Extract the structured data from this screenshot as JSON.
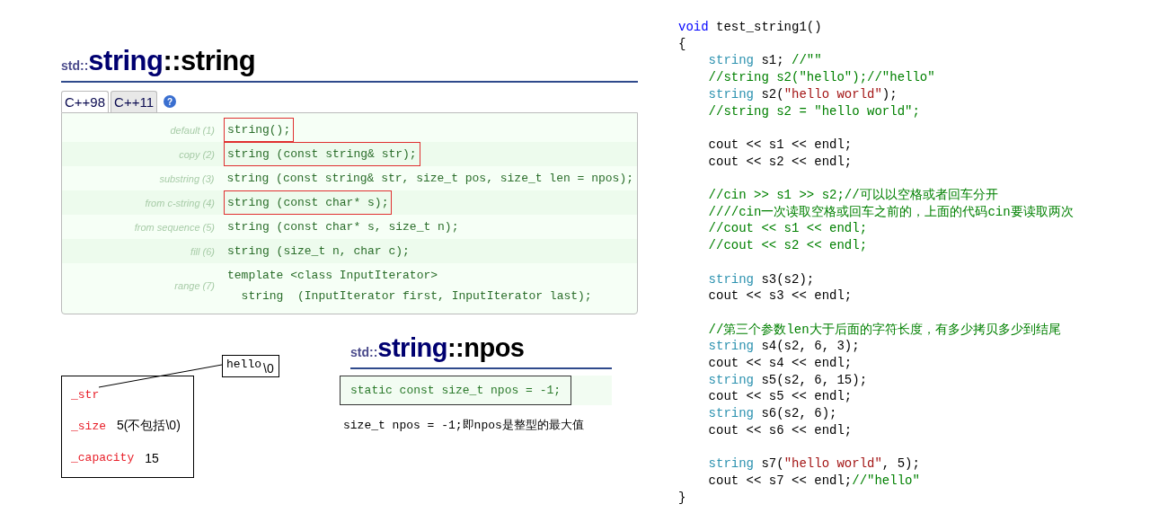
{
  "reference": {
    "title": {
      "namespace": "std::",
      "class_name": "string",
      "member": "::string"
    },
    "tabs": [
      {
        "label": "C++98",
        "selected": true
      },
      {
        "label": "C++11",
        "selected": false
      }
    ],
    "help": "?",
    "overloads": [
      {
        "label": "default (1)",
        "code": [
          "string();"
        ],
        "boxed": true
      },
      {
        "label": "copy (2)",
        "code": [
          "string (const string& str);"
        ],
        "boxed": true
      },
      {
        "label": "substring (3)",
        "code": [
          "string (const string& str, size_t pos, size_t len = npos);"
        ],
        "boxed": false
      },
      {
        "label": "from c-string (4)",
        "code": [
          "string (const char* s);"
        ],
        "boxed": true
      },
      {
        "label": "from sequence (5)",
        "code": [
          "string (const char* s, size_t n);"
        ],
        "boxed": false
      },
      {
        "label": "fill (6)",
        "code": [
          "string (size_t n, char c);"
        ],
        "boxed": false
      },
      {
        "label": "range (7)",
        "code": [
          "template <class InputIterator>",
          "  string  (InputIterator first, InputIterator last);"
        ],
        "boxed": false
      }
    ]
  },
  "diagram": {
    "fields": [
      {
        "name": "_str"
      },
      {
        "name": "_size",
        "value": "5(不包括\\0)"
      },
      {
        "name": "_capacity",
        "value": "15"
      }
    ],
    "buffer": {
      "text": "hello",
      "terminator": "\\0"
    }
  },
  "npos": {
    "title": {
      "namespace": "std::",
      "class_name": "string",
      "member": "::npos"
    },
    "declaration": "static const size_t npos = -1;",
    "note": "size_t npos = -1;即npos是整型的最大值"
  },
  "code": {
    "blocks": [
      {
        "lines": [
          [
            {
              "kind": "keyword",
              "text": "void"
            },
            {
              "kind": "plain",
              "text": " test_string1()"
            }
          ],
          [
            {
              "kind": "plain",
              "text": "{"
            }
          ],
          [
            {
              "kind": "type",
              "text": "    string"
            },
            {
              "kind": "plain",
              "text": " s1; "
            },
            {
              "kind": "comment",
              "text": "//\"\""
            }
          ],
          [
            {
              "kind": "comment",
              "text": "    //string s2(\"hello\");//\"hello\""
            }
          ],
          [
            {
              "kind": "type",
              "text": "    string"
            },
            {
              "kind": "plain",
              "text": " s2("
            },
            {
              "kind": "literal",
              "text": "\"hello world\""
            },
            {
              "kind": "plain",
              "text": ");"
            }
          ],
          [
            {
              "kind": "comment",
              "text": "    //string s2 = \"hello world\";"
            }
          ]
        ]
      },
      {
        "lines": [
          [
            {
              "kind": "plain",
              "text": "    cout << s1 << endl;"
            }
          ],
          [
            {
              "kind": "plain",
              "text": "    cout << s2 << endl;"
            }
          ]
        ]
      },
      {
        "lines": [
          [
            {
              "kind": "comment",
              "text": "    //cin >> s1 >> s2;//可以以空格或者回车分开"
            }
          ],
          [
            {
              "kind": "comment",
              "text": "    ////cin一次读取空格或回车之前的，上面的代码cin要读取两次"
            }
          ],
          [
            {
              "kind": "comment",
              "text": "    //cout << s1 << endl;"
            }
          ],
          [
            {
              "kind": "comment",
              "text": "    //cout << s2 << endl;"
            }
          ]
        ]
      },
      {
        "lines": [
          [
            {
              "kind": "type",
              "text": "    string"
            },
            {
              "kind": "plain",
              "text": " s3(s2);"
            }
          ],
          [
            {
              "kind": "plain",
              "text": "    cout << s3 << endl;"
            }
          ]
        ]
      },
      {
        "lines": [
          [
            {
              "kind": "comment",
              "text": "    //第三个参数len大于后面的字符长度，有多少拷贝多少到结尾"
            }
          ],
          [
            {
              "kind": "type",
              "text": "    string"
            },
            {
              "kind": "plain",
              "text": " s4(s2, 6, 3);"
            }
          ],
          [
            {
              "kind": "plain",
              "text": "    cout << s4 << endl;"
            }
          ],
          [
            {
              "kind": "type",
              "text": "    string"
            },
            {
              "kind": "plain",
              "text": " s5(s2, 6, 15);"
            }
          ],
          [
            {
              "kind": "plain",
              "text": "    cout << s5 << endl;"
            }
          ],
          [
            {
              "kind": "type",
              "text": "    string"
            },
            {
              "kind": "plain",
              "text": " s6(s2, 6);"
            }
          ],
          [
            {
              "kind": "plain",
              "text": "    cout << s6 << endl;"
            }
          ]
        ]
      },
      {
        "lines": [
          [
            {
              "kind": "type",
              "text": "    string"
            },
            {
              "kind": "plain",
              "text": " s7("
            },
            {
              "kind": "literal",
              "text": "\"hello world\""
            },
            {
              "kind": "plain",
              "text": ", 5);"
            }
          ],
          [
            {
              "kind": "plain",
              "text": "    cout << s7 << endl;"
            },
            {
              "kind": "comment",
              "text": "//\"hello\""
            }
          ],
          [
            {
              "kind": "plain",
              "text": "}"
            }
          ]
        ]
      }
    ]
  }
}
